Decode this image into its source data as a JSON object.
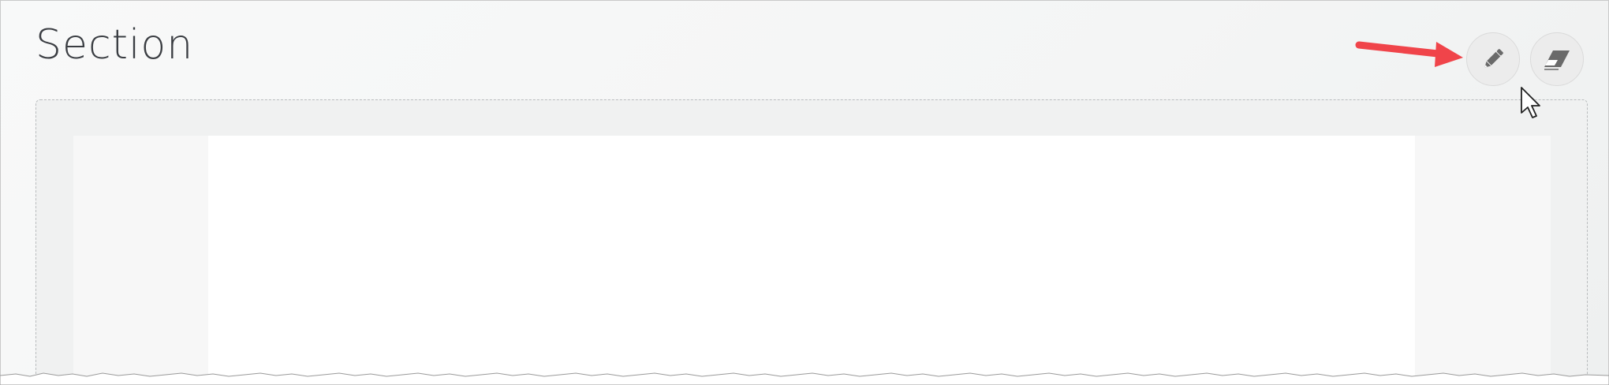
{
  "section": {
    "title": "Section"
  },
  "toolbar": {
    "edit_icon": "pencil-icon",
    "clear_icon": "eraser-icon"
  },
  "annotation": {
    "arrow_color": "#f0444a"
  },
  "colors": {
    "background": "#f6f7f7",
    "content": "#ffffff",
    "icon": "#6a6a6a"
  }
}
